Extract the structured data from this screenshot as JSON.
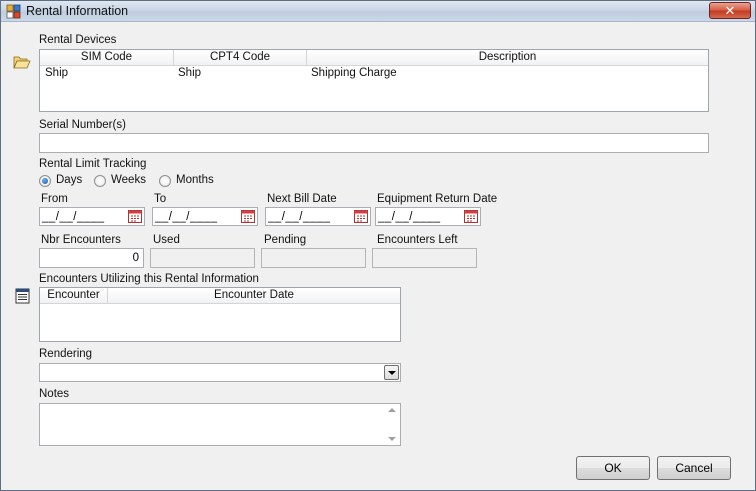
{
  "window": {
    "title": "Rental Information",
    "close_glyph": "✕"
  },
  "rental_devices": {
    "label": "Rental Devices",
    "columns": [
      "SIM Code",
      "CPT4 Code",
      "Description"
    ],
    "rows": [
      {
        "sim": "Ship",
        "cpt4": "Ship",
        "description": "Shipping Charge"
      }
    ]
  },
  "serial": {
    "label": "Serial Number(s)",
    "value": ""
  },
  "tracking": {
    "label": "Rental Limit Tracking",
    "options": [
      {
        "label": "Days",
        "checked": true
      },
      {
        "label": "Weeks",
        "checked": false
      },
      {
        "label": "Months",
        "checked": false
      }
    ]
  },
  "dates": {
    "from_label": "From",
    "to_label": "To",
    "next_bill_label": "Next Bill Date",
    "return_label": "Equipment Return Date",
    "placeholder": "__/__/____"
  },
  "encounters": {
    "nbr_label": "Nbr Encounters",
    "nbr_value": "0",
    "used_label": "Used",
    "pending_label": "Pending",
    "left_label": "Encounters Left"
  },
  "utilizing": {
    "label": "Encounters Utilizing this Rental Information",
    "columns": [
      "Encounter",
      "Encounter Date"
    ]
  },
  "rendering": {
    "label": "Rendering",
    "value": ""
  },
  "notes": {
    "label": "Notes",
    "value": ""
  },
  "buttons": {
    "ok": "OK",
    "cancel": "Cancel"
  },
  "icons": {
    "open": "folder-open-icon",
    "list": "list-icon",
    "calendar": "calendar-icon"
  }
}
